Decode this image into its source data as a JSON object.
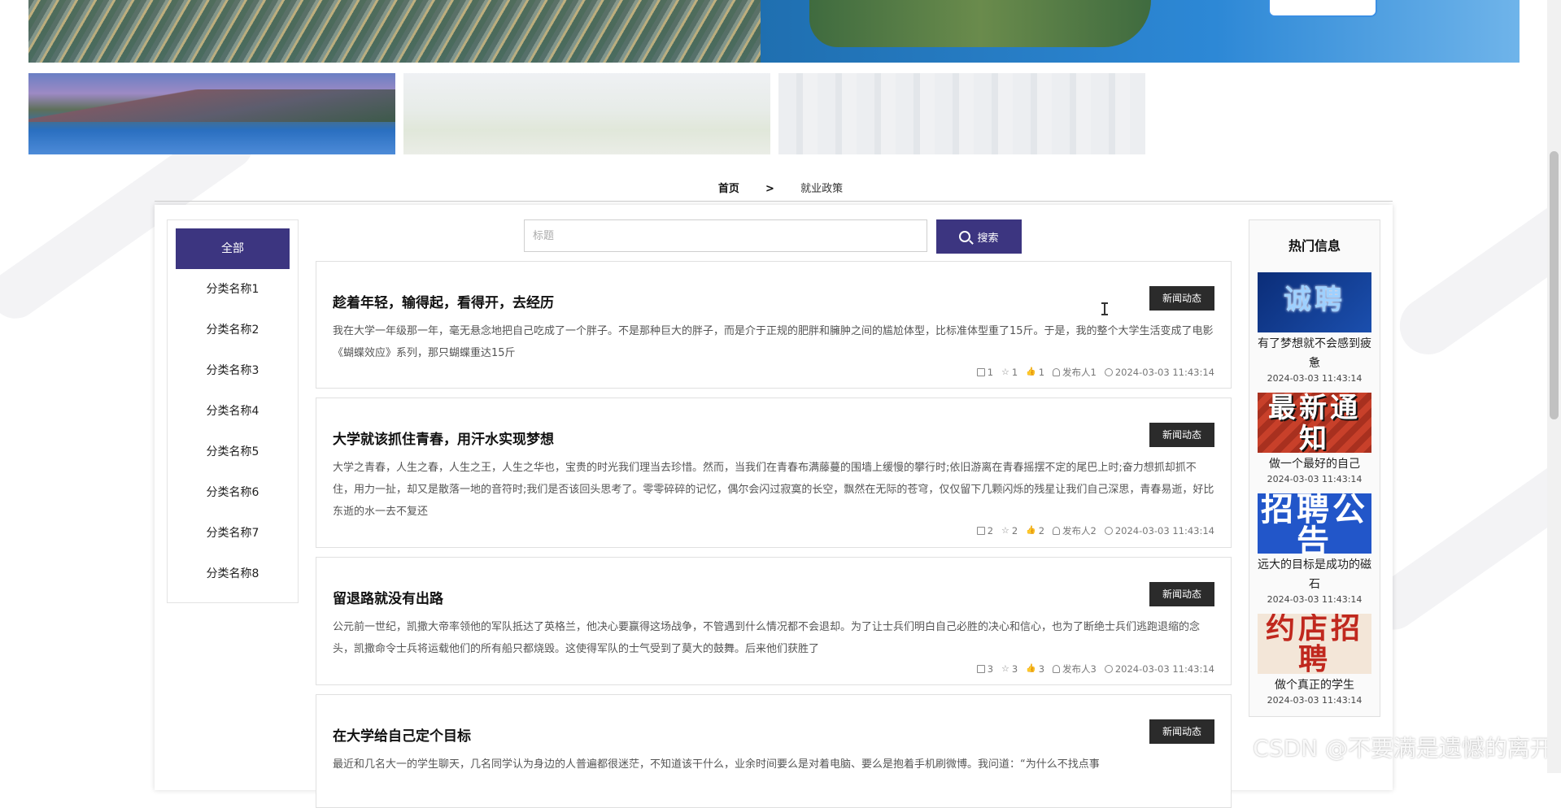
{
  "banner": {
    "upload_label": ""
  },
  "breadcrumb": {
    "home": "首页",
    "separator": ">",
    "current": "就业政策"
  },
  "categories": [
    {
      "label": "全部"
    },
    {
      "label": "分类名称1"
    },
    {
      "label": "分类名称2"
    },
    {
      "label": "分类名称3"
    },
    {
      "label": "分类名称4"
    },
    {
      "label": "分类名称5"
    },
    {
      "label": "分类名称6"
    },
    {
      "label": "分类名称7"
    },
    {
      "label": "分类名称8"
    }
  ],
  "search": {
    "placeholder": "标题",
    "button_label": "搜索"
  },
  "news": [
    {
      "title": "趁着年轻，输得起，看得开，去经历",
      "tag": "新闻动态",
      "body": "我在大学一年级那一年，毫无悬念地把自己吃成了一个胖子。不是那种巨大的胖子，而是介于正规的肥胖和臃肿之间的尴尬体型，比标准体型重了15斤。于是，我的整个大学生活变成了电影《蝴蝶效应》系列，那只蝴蝶重达15斤",
      "views": "1",
      "stars": "1",
      "likes": "1",
      "author": "发布人1",
      "time": "2024-03-03 11:43:14"
    },
    {
      "title": "大学就该抓住青春，用汗水实现梦想",
      "tag": "新闻动态",
      "body": "大学之青春，人生之春，人生之王，人生之华也，宝贵的时光我们理当去珍惜。然而，当我们在青春布满藤蔓的围墙上缓慢的攀行时;依旧游离在青春摇摆不定的尾巴上时;奋力想抓却抓不住，用力一扯，却又是散落一地的音符时;我们是否该回头思考了。零零碎碎的记忆，偶尔会闪过寂寞的长空，飘然在无际的苍穹，仅仅留下几颗闪烁的残星让我们自己深思，青春易逝，好比东逝的水一去不复还",
      "views": "2",
      "stars": "2",
      "likes": "2",
      "author": "发布人2",
      "time": "2024-03-03 11:43:14"
    },
    {
      "title": "留退路就没有出路",
      "tag": "新闻动态",
      "body": "公元前一世纪，凯撒大帝率领他的军队抵达了英格兰，他决心要赢得这场战争，不管遇到什么情况都不会退却。为了让士兵们明白自己必胜的决心和信心，也为了断绝士兵们逃跑退缩的念头，凯撒命令士兵将运载他们的所有船只都烧毁。这使得军队的士气受到了莫大的鼓舞。后来他们获胜了",
      "views": "3",
      "stars": "3",
      "likes": "3",
      "author": "发布人3",
      "time": "2024-03-03 11:43:14"
    },
    {
      "title": "在大学给自己定个目标",
      "tag": "新闻动态",
      "body": "最近和几名大一的学生聊天，几名同学认为身边的人普遍都很迷茫，不知道该干什么，业余时间要么是对着电脑、要么是抱着手机刷微博。我问道：“为什么不找点事"
    }
  ],
  "hot": {
    "title": "热门信息",
    "items": [
      {
        "image_text": "诚聘",
        "caption": "有了梦想就不会感到疲惫",
        "time": "2024-03-03 11:43:14"
      },
      {
        "image_text": "最新通知",
        "caption": "做一个最好的自己",
        "time": "2024-03-03 11:43:14"
      },
      {
        "image_text": "招聘公告",
        "caption": "远大的目标是成功的磁石",
        "time": "2024-03-03 11:43:14"
      },
      {
        "image_text": "约店招聘",
        "caption": "做个真正的学生",
        "time": "2024-03-03 11:43:14"
      }
    ]
  },
  "watermark": "CSDN @不要满是遗憾的离开",
  "colors": {
    "primary": "#3c3580",
    "tag_bg": "#2b2b2b",
    "scroll_thumb": "#c1c1c1"
  }
}
